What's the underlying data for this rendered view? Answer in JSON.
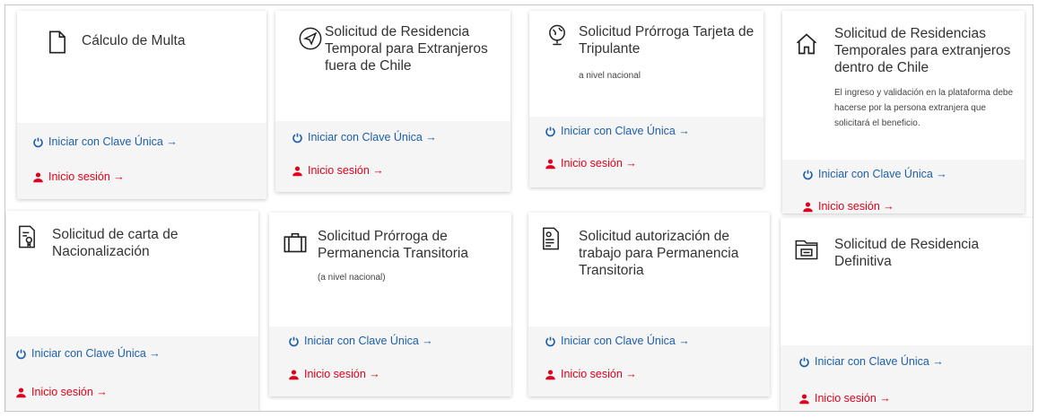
{
  "cards": [
    {
      "title": "Cálculo de Multa",
      "sub": "",
      "icon": "document-icon",
      "clave": "Iniciar con Clave Única →",
      "sesion": "Inicio sesión →"
    },
    {
      "title": "Solicitud de Residencia Temporal para Extranjeros fuera de Chile",
      "sub": "",
      "icon": "send-icon",
      "clave": "Iniciar con Clave Única →",
      "sesion": "Inicio sesión →"
    },
    {
      "title": "Solicitud Prórroga Tarjeta de Tripulante",
      "sub": "a nivel nacional",
      "icon": "globe-icon",
      "clave": "Iniciar con Clave Única →",
      "sesion": "Inicio sesión →"
    },
    {
      "title": "Solicitud de Residencias Temporales para extranjeros dentro de Chile",
      "sub": "El ingreso y validación en la plataforma debe hacerse por la persona extranjera que solicitará el beneficio.",
      "icon": "home-icon",
      "clave": "Iniciar con Clave Única →",
      "sesion": "Inicio sesión →"
    },
    {
      "title": "Solicitud de carta de Nacionalización",
      "sub": "",
      "icon": "certificate-icon",
      "clave": "Iniciar con Clave Única →",
      "sesion": "Inicio sesión →"
    },
    {
      "title": "Solicitud Prórroga de Permanencia Transitoria",
      "sub": "(a nivel nacional)",
      "icon": "briefcase-icon",
      "clave": "Iniciar con Clave Única →",
      "sesion": "Inicio sesión →"
    },
    {
      "title": "Solicitud autorización de trabajo para Permanencia Transitoria",
      "sub": "",
      "icon": "id-card-icon",
      "clave": "Iniciar con Clave Única →",
      "sesion": "Inicio sesión →"
    },
    {
      "title": "Solicitud de Residencia Definitiva",
      "sub": "",
      "icon": "folder-icon",
      "clave": "Iniciar con Clave Única →",
      "sesion": "Inicio sesión →"
    }
  ],
  "colors": {
    "clave": "#1d5fa8",
    "sesion": "#e0001b"
  }
}
